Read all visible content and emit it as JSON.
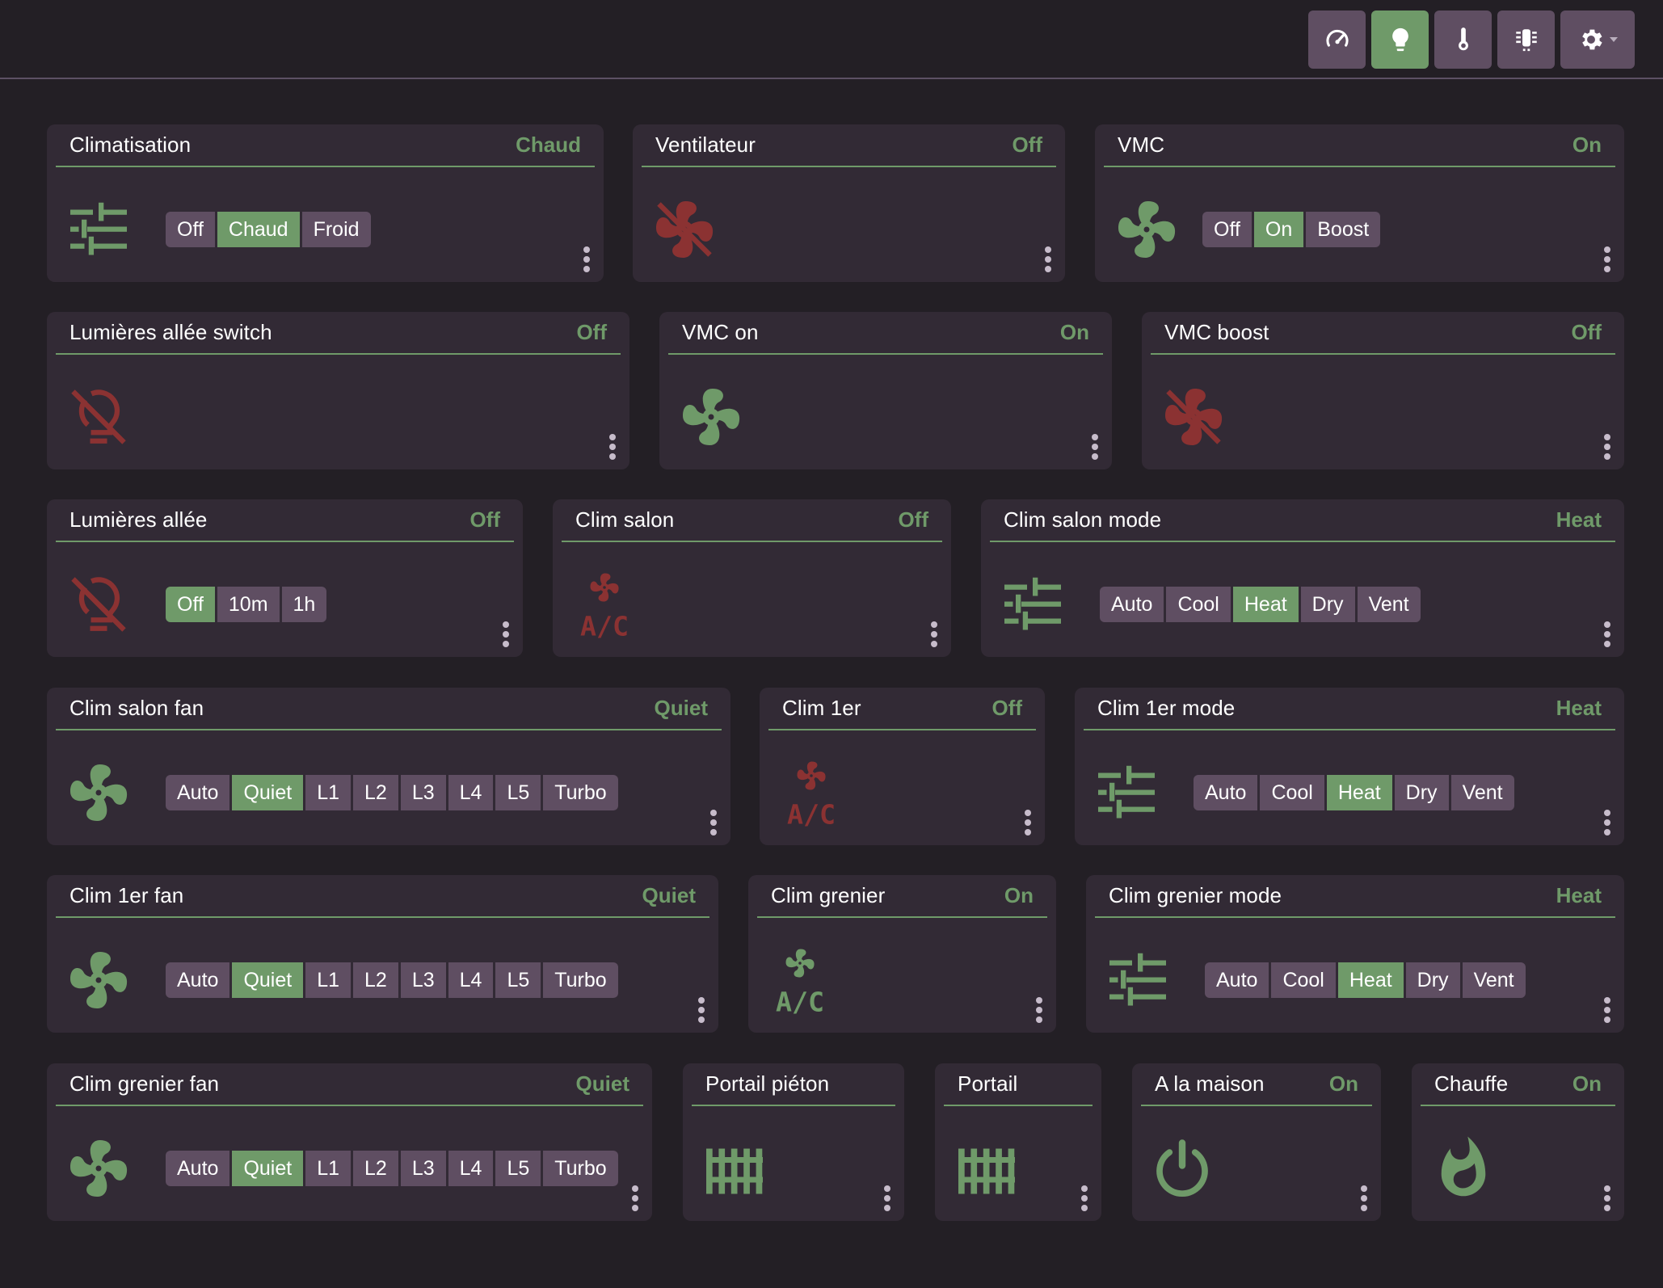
{
  "colors": {
    "background": "#231f25",
    "card": "#322a35",
    "button": "#5f4e62",
    "accent": "#6f9a69",
    "off": "#8b3232"
  },
  "nav": [
    {
      "icon": "gauge-icon",
      "active": false
    },
    {
      "icon": "lightbulb-icon",
      "active": true
    },
    {
      "icon": "thermometer-icon",
      "active": false
    },
    {
      "icon": "radiator-icon",
      "active": false
    },
    {
      "icon": "gear-icon",
      "active": false,
      "dropdown": true
    }
  ],
  "cards": {
    "climatisation": {
      "title": "Climatisation",
      "state": "Chaud",
      "icon": "sliders-icon",
      "options": [
        "Off",
        "Chaud",
        "Froid"
      ],
      "selected": "Chaud"
    },
    "ventilateur": {
      "title": "Ventilateur",
      "state": "Off",
      "icon": "fan-off-icon"
    },
    "vmc": {
      "title": "VMC",
      "state": "On",
      "icon": "fan-icon",
      "options": [
        "Off",
        "On",
        "Boost"
      ],
      "selected": "On"
    },
    "lumieres_switch": {
      "title": "Lumières allée switch",
      "state": "Off",
      "icon": "lightbulb-off-icon"
    },
    "vmc_on": {
      "title": "VMC on",
      "state": "On",
      "icon": "fan-icon"
    },
    "vmc_boost": {
      "title": "VMC boost",
      "state": "Off",
      "icon": "fan-off-icon"
    },
    "lumieres": {
      "title": "Lumières allée",
      "state": "Off",
      "icon": "lightbulb-off-icon",
      "options": [
        "Off",
        "10m",
        "1h"
      ],
      "selected": "Off"
    },
    "clim_salon": {
      "title": "Clim salon",
      "state": "Off",
      "icon": "air-conditioner-icon"
    },
    "clim_salon_mode": {
      "title": "Clim salon mode",
      "state": "Heat",
      "icon": "sliders-icon",
      "options": [
        "Auto",
        "Cool",
        "Heat",
        "Dry",
        "Vent"
      ],
      "selected": "Heat"
    },
    "clim_salon_fan": {
      "title": "Clim salon fan",
      "state": "Quiet",
      "icon": "fan-icon",
      "options": [
        "Auto",
        "Quiet",
        "L1",
        "L2",
        "L3",
        "L4",
        "L5",
        "Turbo"
      ],
      "selected": "Quiet"
    },
    "clim_1er": {
      "title": "Clim 1er",
      "state": "Off",
      "icon": "air-conditioner-icon"
    },
    "clim_1er_mode": {
      "title": "Clim 1er mode",
      "state": "Heat",
      "icon": "sliders-icon",
      "options": [
        "Auto",
        "Cool",
        "Heat",
        "Dry",
        "Vent"
      ],
      "selected": "Heat"
    },
    "clim_1er_fan": {
      "title": "Clim 1er fan",
      "state": "Quiet",
      "icon": "fan-icon",
      "options": [
        "Auto",
        "Quiet",
        "L1",
        "L2",
        "L3",
        "L4",
        "L5",
        "Turbo"
      ],
      "selected": "Quiet"
    },
    "clim_grenier": {
      "title": "Clim grenier",
      "state": "On",
      "icon": "air-conditioner-icon"
    },
    "clim_grenier_mode": {
      "title": "Clim grenier mode",
      "state": "Heat",
      "icon": "sliders-icon",
      "options": [
        "Auto",
        "Cool",
        "Heat",
        "Dry",
        "Vent"
      ],
      "selected": "Heat"
    },
    "clim_grenier_fan": {
      "title": "Clim grenier fan",
      "state": "Quiet",
      "icon": "fan-icon",
      "options": [
        "Auto",
        "Quiet",
        "L1",
        "L2",
        "L3",
        "L4",
        "L5",
        "Turbo"
      ],
      "selected": "Quiet"
    },
    "portail_pieton": {
      "title": "Portail piéton",
      "state": "",
      "icon": "gate-icon"
    },
    "portail": {
      "title": "Portail",
      "state": "",
      "icon": "gate-icon"
    },
    "a_la_maison": {
      "title": "A la maison",
      "state": "On",
      "icon": "power-icon"
    },
    "chauffe": {
      "title": "Chauffe",
      "state": "On",
      "icon": "fire-icon"
    }
  }
}
